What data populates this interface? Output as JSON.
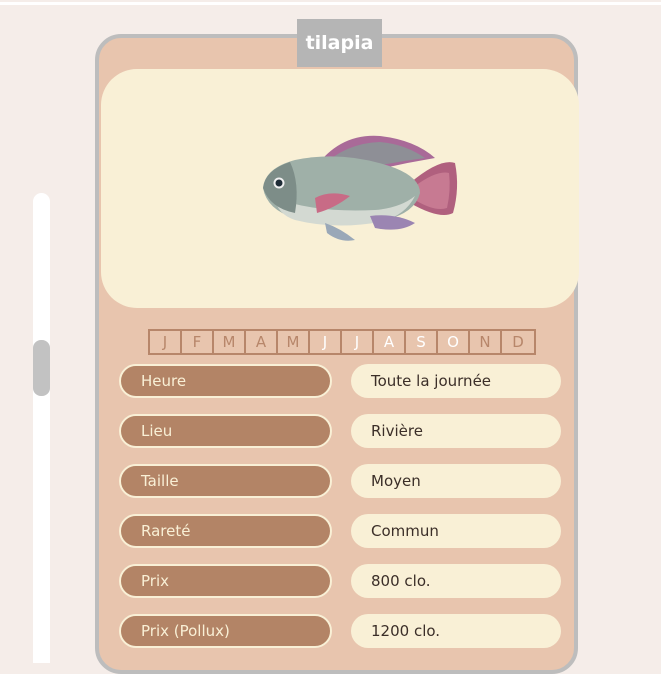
{
  "title": "tilapia",
  "image": {
    "icon": "fish-icon"
  },
  "months": [
    {
      "label": "J",
      "active": false
    },
    {
      "label": "F",
      "active": false
    },
    {
      "label": "M",
      "active": false
    },
    {
      "label": "A",
      "active": false
    },
    {
      "label": "M",
      "active": false
    },
    {
      "label": "J",
      "active": true
    },
    {
      "label": "J",
      "active": true
    },
    {
      "label": "A",
      "active": true
    },
    {
      "label": "S",
      "active": true
    },
    {
      "label": "O",
      "active": true
    },
    {
      "label": "N",
      "active": false
    },
    {
      "label": "D",
      "active": false
    }
  ],
  "rows": [
    {
      "label": "Heure",
      "value": "Toute la journée"
    },
    {
      "label": "Lieu",
      "value": "Rivière"
    },
    {
      "label": "Taille",
      "value": "Moyen"
    },
    {
      "label": "Rareté",
      "value": "Commun"
    },
    {
      "label": "Prix",
      "value": "800 clo."
    },
    {
      "label": "Prix (Pollux)",
      "value": "1200 clo."
    }
  ],
  "colors": {
    "background": "#f5ede9",
    "card": "#e8c5ae",
    "card_border": "#bdbdbd",
    "panel": "#f9f0d6",
    "label_pill": "#b38466",
    "month_inactive": "#b7866a",
    "month_active": "#ffffff"
  }
}
